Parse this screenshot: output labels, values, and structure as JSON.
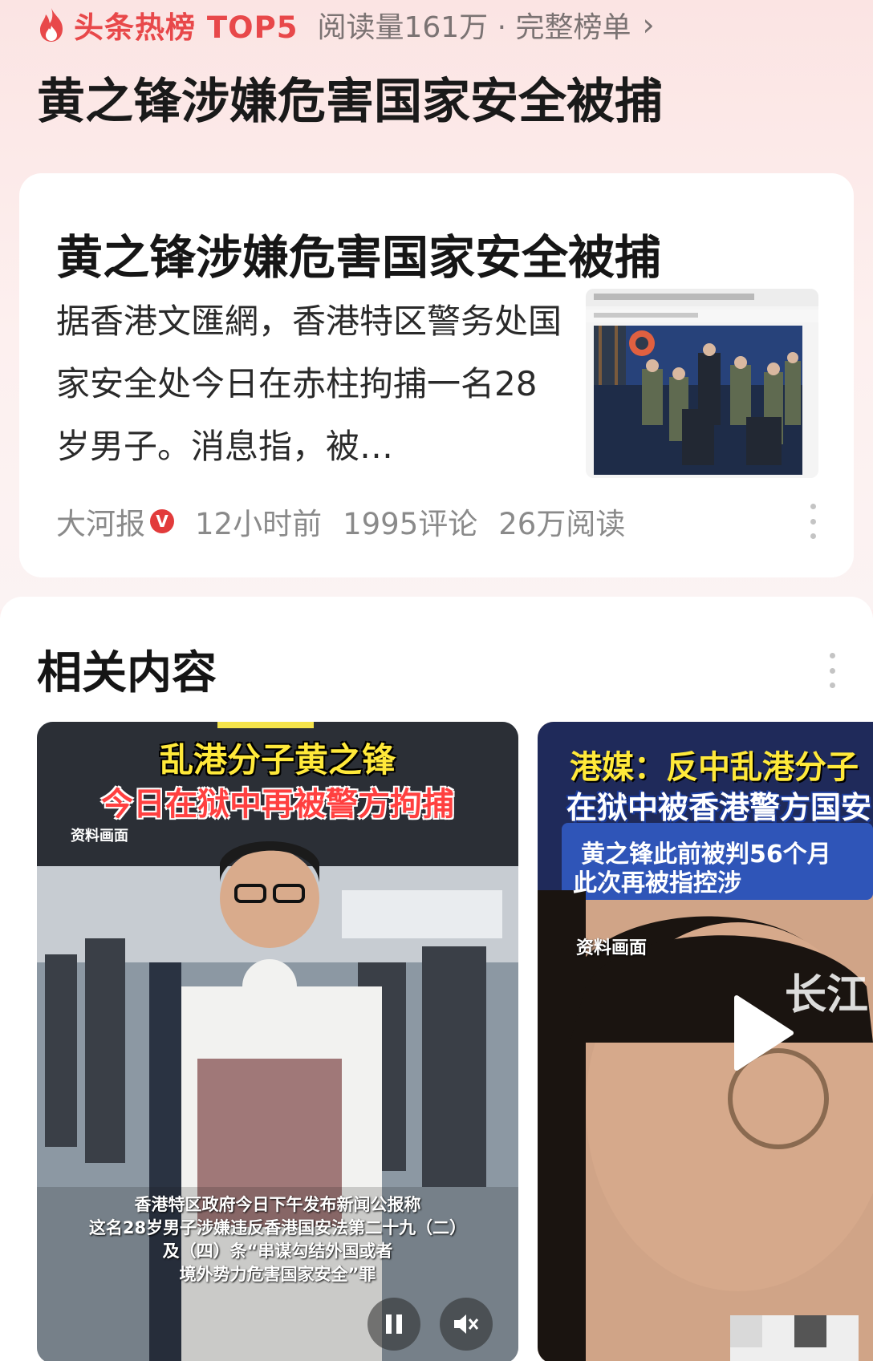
{
  "hot_list": {
    "title": "头条热榜 TOP5",
    "meta": "阅读量161万 · 完整榜单",
    "chevron": "›",
    "icon": "flame-icon",
    "color": "#e8484a"
  },
  "headline": "黄之锋涉嫌危害国家安全被捕",
  "article": {
    "title": "黄之锋涉嫌危害国家安全被捕",
    "summary": "据香港文匯網，香港特区警务处国家安全处今日在赤柱拘捕一名28岁男子。消息指，被…",
    "source": "大河报",
    "verified_badge": "V",
    "time": "12小时前",
    "comments": "1995评论",
    "reads": "26万阅读"
  },
  "related": {
    "title": "相关内容",
    "videos": [
      {
        "caption_top": "乱港分子黄之锋",
        "caption_sub": "今日在狱中再被警方拘捕",
        "label": "资料画面",
        "subtitle_lines": [
          "香港特区政府今日下午发布新闻公报称",
          "这名28岁男子涉嫌违反香港国安法第二十九（二）",
          "及（四）条“串谋勾结外国或者",
          "境外势力危害国家安全”罪"
        ]
      },
      {
        "caption_top": "港媒：反中乱港分子",
        "caption_sub": "在狱中被香港警方国安",
        "caption_box_1": "黄之锋此前被判56个月",
        "caption_box_2": "此次再被指控涉",
        "label": "资料画面",
        "watermark": "长江"
      }
    ]
  }
}
